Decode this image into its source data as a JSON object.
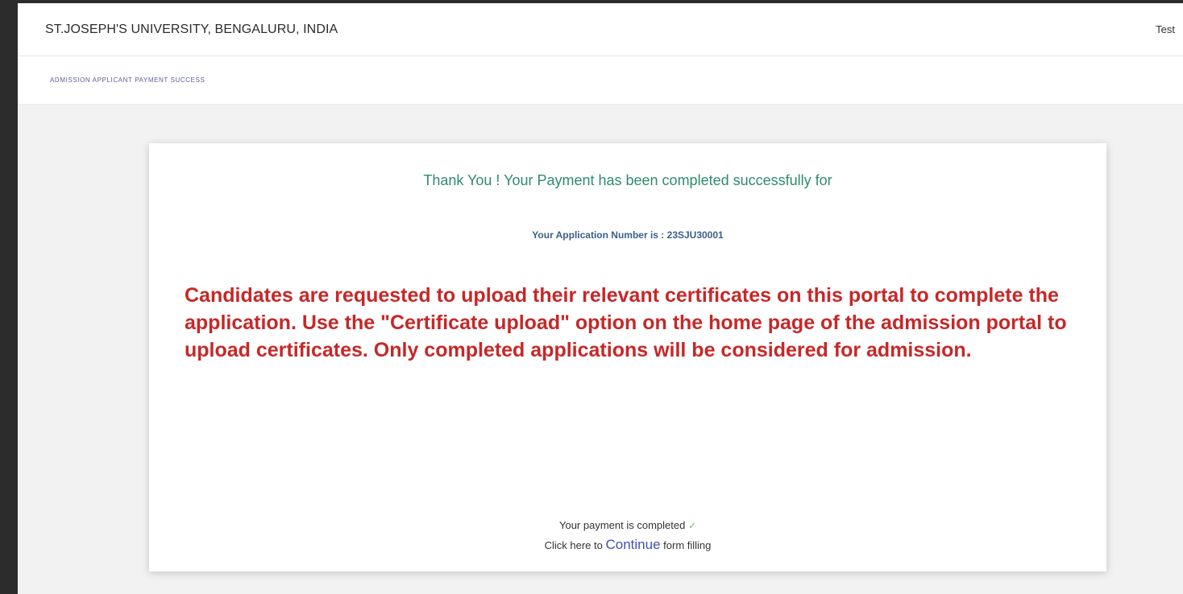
{
  "header": {
    "brand": "ST.JOSEPH'S UNIVERSITY, BENGALURU, INDIA",
    "user": "Test"
  },
  "breadcrumb": {
    "label": "ADMISSION APPLICANT PAYMENT SUCCESS"
  },
  "card": {
    "thanks": "Thank You ! Your Payment has been completed successfully for",
    "application_number": "Your Application Number is : 23SJU30001",
    "notice": "Candidates are requested to upload their relevant certificates on this portal to complete the application. Use the \"Certificate upload\" option on the home page of the admission portal to upload certificates. Only completed applications will be considered for admission.",
    "payment_status": "Your payment is completed",
    "check_glyph": "✓",
    "click_prefix": "Click here to",
    "continue_label": "Continue",
    "click_suffix": "form filling"
  },
  "colors": {
    "success": "#2e8b6e",
    "notice": "#c62828",
    "link": "#3f51b5"
  },
  "icons": {
    "status": "check-icon"
  }
}
